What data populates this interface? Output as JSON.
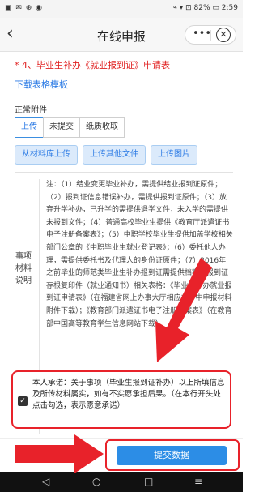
{
  "status_bar": {
    "left": "▣ ✉ ⊕ ◉",
    "right": "⌁ ▾ ⊡ 82% ▭ 2:59"
  },
  "nav": {
    "title": "在线申报",
    "back_icon": "‹",
    "more_icon": "•••",
    "close_icon": "⊗"
  },
  "form": {
    "section_title": "* 4、毕业生补办《就业报到证》申请表",
    "download_link": "下载表格模板",
    "attachment_label": "正常附件",
    "tabs": [
      "上传",
      "未提交",
      "纸质收取"
    ],
    "upload_buttons": [
      "从材料库上传",
      "上传其他文件",
      "上传图片"
    ]
  },
  "notes": {
    "label": "事项材料说明",
    "text": "注：（1）结业变更毕业补办，需提供结业报到证原件；（2）报到证信息错误补办，需提供报到证原件；（3）放弃升学补办，已升学的需提供退学文件，未入学的需提供未报到文件；（4）普通高校毕业生提供《教育厅派遣证书电子注册备案表》；（5）中职学校毕业生提供加盖学校相关部门公章的《中职毕业生就业登记表》；（6）委托他人办理，需提供委托书及代理人的身份证原件；（7）2016年之前毕业的师范类毕业生补办报到证需提供档案中报到证存根复印件（就业通知书）相关表格：《毕业生补办就业报到证申请表》（在福建省网上办事大厅相应办件中申报材料附件下载）；《教育部门派遣证书电子注册备案表》（在教育部中国高等教育学生信息网站下载）"
  },
  "consent": {
    "checkbox_mark": "✓",
    "text": "本人承诺：关于事项（毕业生报到证补办）以上所填信息及所传材料属实，如有不实愿承担后果。（在本行开头处点击勾选，表示愿意承诺）"
  },
  "submit": {
    "label": "提交数据"
  },
  "system_nav": {
    "back": "◁",
    "home": "○",
    "recent": "□",
    "menu": "≡"
  },
  "colors": {
    "accent": "#2c8de6",
    "highlight_red": "#e8222a",
    "link": "#2c7be5",
    "required_red": "#e02020"
  }
}
